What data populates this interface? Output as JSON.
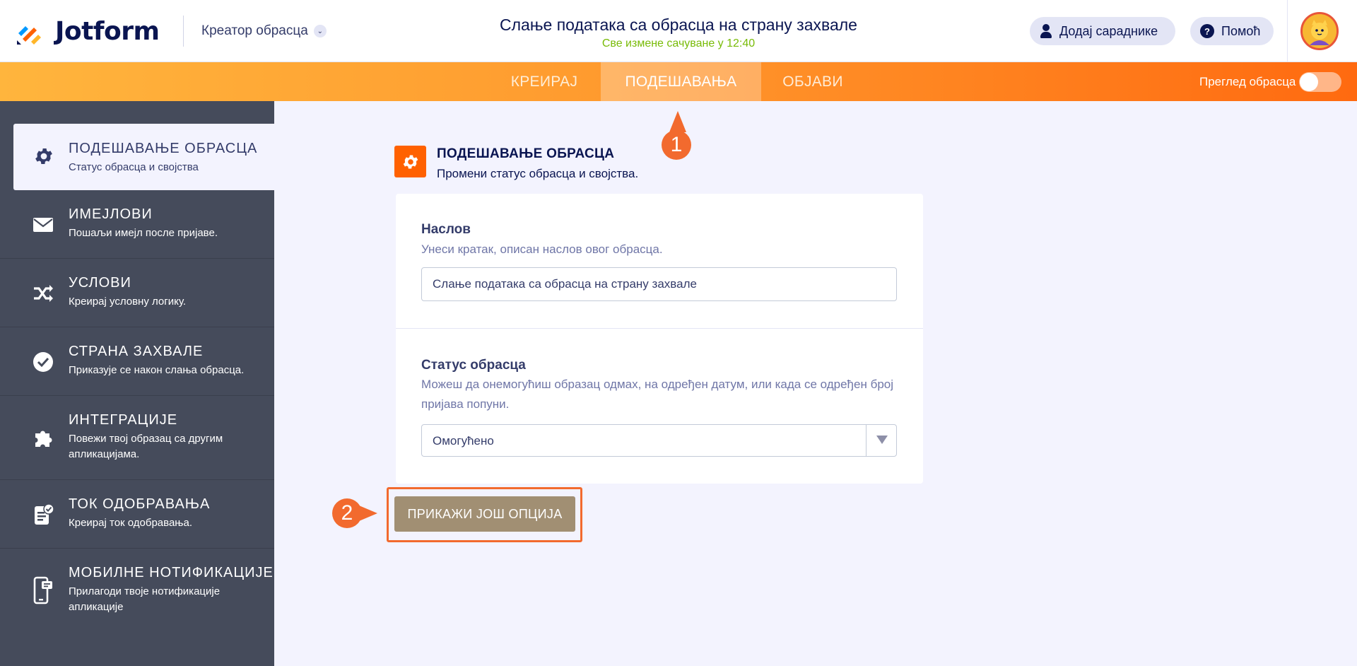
{
  "header": {
    "brand": "Jotform",
    "builder_label": "Креатор обрасца",
    "form_title": "Слање података са обрасца на страну захвале",
    "saved_status": "Све измене сачуване у 12:40",
    "add_collaborators": "Додај сараднике",
    "help": "Помоћ"
  },
  "nav": {
    "tabs": [
      "КРЕИРАЈ",
      "ПОДЕШАВАЊА",
      "ОБЈАВИ"
    ],
    "active_tab": "ПОДЕШАВАЊА",
    "preview_label": "Преглед обрасца",
    "preview_enabled": false
  },
  "sidebar": {
    "items": [
      {
        "title": "ПОДЕШАВАЊЕ ОБРАСЦА",
        "subtitle": "Статус обрасца и својства",
        "icon": "gear-icon",
        "active": true
      },
      {
        "title": "ИМЕЈЛОВИ",
        "subtitle": "Пошаљи имејл после пријаве.",
        "icon": "envelope-icon"
      },
      {
        "title": "УСЛОВИ",
        "subtitle": "Креирај условну логику.",
        "icon": "shuffle-icon"
      },
      {
        "title": "СТРАНА ЗАХВАЛЕ",
        "subtitle": "Приказује се након слања обрасца.",
        "icon": "check-circle-icon"
      },
      {
        "title": "ИНТЕГРАЦИЈЕ",
        "subtitle": "Повежи твој образац са другим апликацијама.",
        "icon": "puzzle-icon"
      },
      {
        "title": "ТОК ОДОБРАВАЊА",
        "subtitle": "Креирај ток одобравања.",
        "icon": "approval-icon"
      },
      {
        "title": "МОБИЛНЕ НОТИФИКАЦИЈЕ",
        "subtitle": "Прилагоди твоје нотификације апликације",
        "icon": "mobile-notification-icon"
      }
    ]
  },
  "markers": {
    "one": "1",
    "two": "2"
  },
  "content": {
    "section_title": "ПОДЕШАВАЊЕ ОБРАСЦА",
    "section_desc": "Промени статус обрасца и својства.",
    "title_label": "Наслов",
    "title_help": "Унеси кратак, описан наслов овог обрасца.",
    "title_value": "Слање података са обрасца на страну захвале",
    "status_label": "Статус обрасца",
    "status_help": "Можеш да онемогућиш образац одмах, на одређен датум, или када се одређен број пријава попуни.",
    "status_value": "Омогућено",
    "more_options": "ПРИКАЖИ ЈОШ ОПЦИЈА"
  },
  "colors": {
    "accent_orange": "#ff6100",
    "sidebar_bg": "#454b5b",
    "saved_green": "#78bb07",
    "more_button": "#a18f73",
    "marker": "#f26a2e"
  }
}
